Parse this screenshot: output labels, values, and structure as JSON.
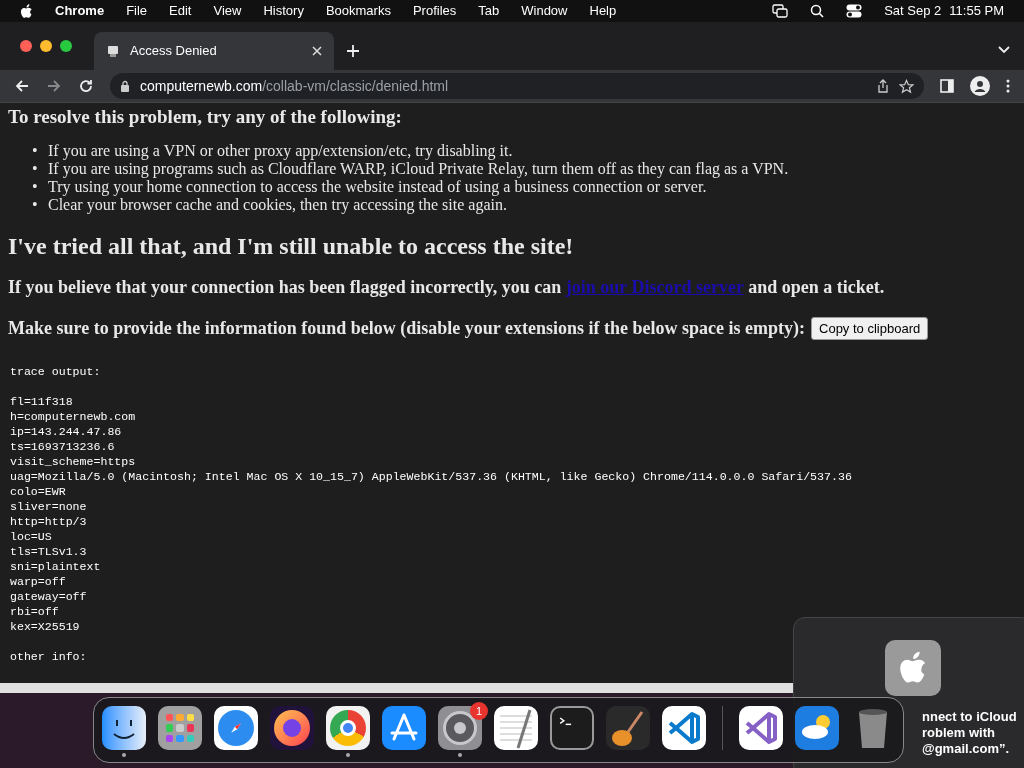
{
  "menu_bar": {
    "app": "Chrome",
    "menus": [
      "File",
      "Edit",
      "View",
      "History",
      "Bookmarks",
      "Profiles",
      "Tab",
      "Window",
      "Help"
    ],
    "date": "Sat Sep 2",
    "time": "11:55 PM"
  },
  "tabs": [
    {
      "title": "Access Denied",
      "selected": true
    }
  ],
  "address_bar": {
    "domain": "computernewb.com",
    "path": "/collab-vm/classic/denied.html"
  },
  "page": {
    "heading": "To resolve this problem, try any of the following:",
    "tips": [
      {
        "marker": "•",
        "text": "If you are using a VPN or other proxy app/extension/etc, try disabling it."
      },
      {
        "marker": "•",
        "text": "If you are using programs such as Cloudflare WARP, iCloud Private Relay, turn them off as they can flag as a VPN."
      },
      {
        "marker": "•",
        "text": "Try using your home connection to access the website instead of using a business connection or server."
      },
      {
        "marker": "•",
        "text": "Clear your browser cache and cookies, then try accessing the site again."
      }
    ],
    "subheading": "I've tried all that, and I'm still unable to access the site!",
    "flagged_text": "If you believe that your connection has been flagged incorrectly, you can",
    "flagged_link": "join our Discord server",
    "flagged_end": "and open a ticket.",
    "provide_text": "Make sure to provide the information found below (disable your extensions if the below space is empty):",
    "copy_button": "Copy to clipboard",
    "trace_groups": [
      [
        "trace output:"
      ],
      [
        "fl=11f318",
        "h=computernewb.com",
        "ip=143.244.47.86",
        "ts=1693713236.6",
        "visit_scheme=https",
        "uag=Mozilla/5.0 (Macintosh; Intel Mac OS X 10_15_7) AppleWebKit/537.36 (KHTML, like Gecko) Chrome/114.0.0.0 Safari/537.36",
        "colo=EWR",
        "sliver=none",
        "http=http/3",
        "loc=US",
        "tls=TLSv1.3",
        "sni=plaintext",
        "warp=off",
        "gateway=off",
        "rbi=off",
        "kex=X25519"
      ],
      [
        "other info:"
      ]
    ]
  },
  "notification": {
    "lines": [
      "nnect to iCloud",
      "roblem with",
      "@gmail.com”."
    ]
  },
  "dock": [
    {
      "kind": "finder",
      "running": true
    },
    {
      "kind": "launchpad",
      "running": false
    },
    {
      "kind": "safari",
      "running": false
    },
    {
      "kind": "firefox",
      "running": false
    },
    {
      "kind": "chrome",
      "running": true
    },
    {
      "kind": "appstore",
      "running": false
    },
    {
      "kind": "settings",
      "running": true,
      "badge": "1"
    },
    {
      "kind": "textedit",
      "running": false
    },
    {
      "kind": "terminal",
      "running": false
    },
    {
      "kind": "garageband",
      "running": false
    },
    {
      "kind": "vscode",
      "running": false
    },
    {
      "kind": "divider"
    },
    {
      "kind": "visualstudio",
      "running": false
    },
    {
      "kind": "weather",
      "running": false
    },
    {
      "kind": "trash",
      "running": false
    }
  ]
}
